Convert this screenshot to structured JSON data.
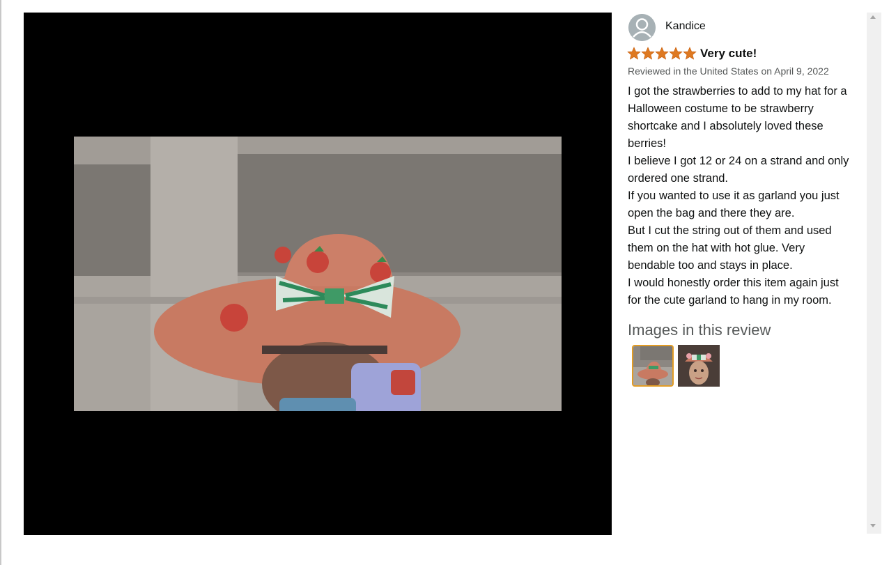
{
  "review": {
    "author": "Kandice",
    "avatar_icon": "person-icon",
    "rating": 5,
    "rating_max": 5,
    "star_color": "#de7921",
    "title": "Very cute!",
    "meta": "Reviewed in the United States on April 9, 2022",
    "body_lines": [
      "I got the strawberries to add to my hat for a",
      "Halloween costume to be strawberry",
      "shortcake and I absolutely loved these",
      "berries!",
      "I believe I got 12 or 24 on a strand and only",
      "ordered one strand.",
      "If you wanted to use it as garland you just",
      "open the bag and there they are.",
      "But I cut the string out of them and used",
      "them on the hat with hot glue. Very",
      "bendable too and stays in place.",
      "I would honestly order this item again just",
      "for the cute garland to hang in my room."
    ]
  },
  "images": {
    "heading": "Images in this review",
    "selected_index": 0,
    "selected_border_color": "#e29c25"
  },
  "viewer": {
    "background": "#000000"
  }
}
